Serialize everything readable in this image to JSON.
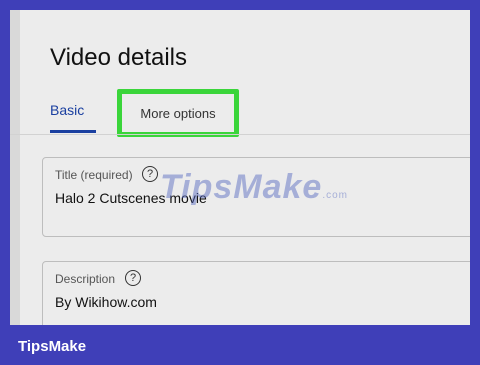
{
  "page": {
    "title": "Video details"
  },
  "tabs": [
    {
      "label": "Basic",
      "active": true
    },
    {
      "label": "More options",
      "highlighted": true
    }
  ],
  "fields": {
    "title": {
      "label": "Title (required)",
      "value": "Halo 2 Cutscenes movie"
    },
    "description": {
      "label": "Description",
      "value": "By Wikihow.com"
    }
  },
  "watermark": {
    "text": "TipsMake",
    "suffix": ".com"
  },
  "footer": {
    "brand": "TipsMake"
  },
  "colors": {
    "accent": "#1a3fa0",
    "highlight": "#3ad53a",
    "frame": "#3f3fb8"
  },
  "icons": {
    "help": "help-circle-icon"
  }
}
